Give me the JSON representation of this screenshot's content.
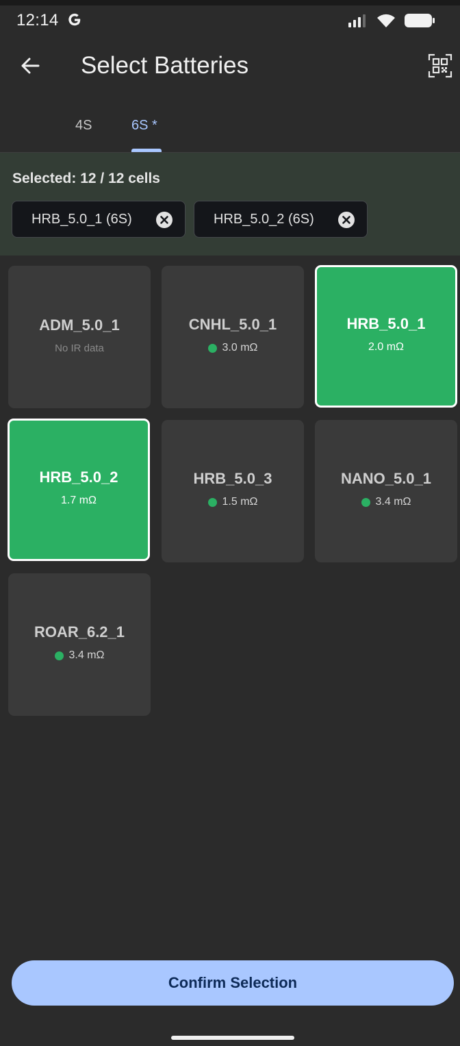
{
  "status_bar": {
    "time": "12:14"
  },
  "app_bar": {
    "title": "Select Batteries"
  },
  "tabs": [
    {
      "label": "4S",
      "active": false
    },
    {
      "label": "6S *",
      "active": true
    }
  ],
  "selection": {
    "summary": "Selected: 12 / 12 cells",
    "chips": [
      {
        "label": "HRB_5.0_1 (6S)"
      },
      {
        "label": "HRB_5.0_2 (6S)"
      }
    ]
  },
  "batteries": [
    {
      "name": "ADM_5.0_1",
      "ir": "No IR data",
      "has_ir": false,
      "selected": false
    },
    {
      "name": "CNHL_5.0_1",
      "ir": "3.0 mΩ",
      "has_ir": true,
      "selected": false
    },
    {
      "name": "HRB_5.0_1",
      "ir": "2.0 mΩ",
      "has_ir": true,
      "selected": true
    },
    {
      "name": "HRB_5.0_2",
      "ir": "1.7 mΩ",
      "has_ir": true,
      "selected": true
    },
    {
      "name": "HRB_5.0_3",
      "ir": "1.5 mΩ",
      "has_ir": true,
      "selected": false
    },
    {
      "name": "NANO_5.0_1",
      "ir": "3.4 mΩ",
      "has_ir": true,
      "selected": false
    },
    {
      "name": "ROAR_6.2_1",
      "ir": "3.4 mΩ",
      "has_ir": true,
      "selected": false
    }
  ],
  "confirm_label": "Confirm Selection",
  "colors": {
    "accent": "#a9c7ff",
    "selected_card": "#2bb063",
    "ir_good": "#2bb063",
    "background": "#2b2b2b"
  },
  "icons": {
    "back": "arrow-left-icon",
    "qr": "qr-scan-icon",
    "chip_close": "close-circle-icon"
  }
}
